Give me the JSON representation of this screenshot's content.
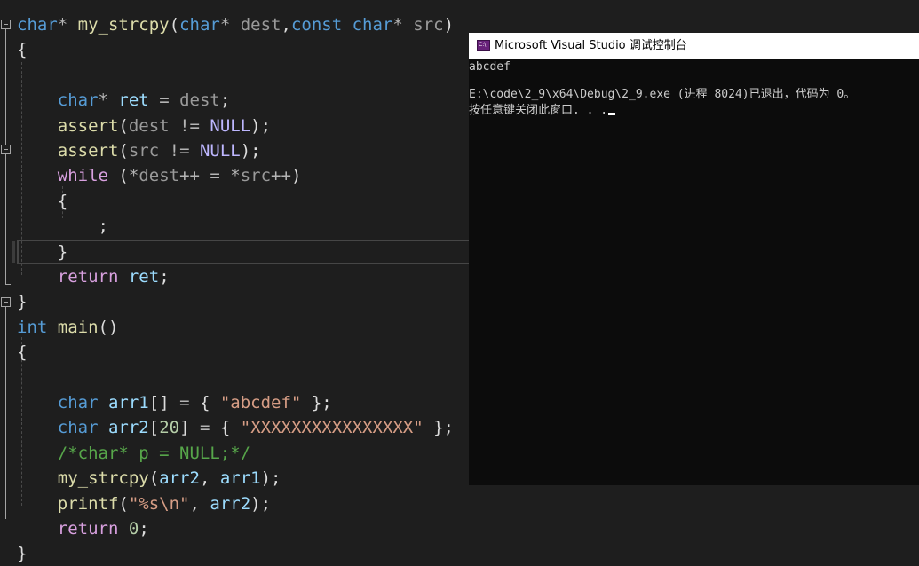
{
  "editor": {
    "lines": [
      [
        [
          "kw",
          "char"
        ],
        [
          "op",
          "* "
        ],
        [
          "fn",
          "my_strcpy"
        ],
        [
          "punct",
          "("
        ],
        [
          "kw",
          "char"
        ],
        [
          "op",
          "* "
        ],
        [
          "param",
          "dest"
        ],
        [
          "punct",
          ","
        ],
        [
          "kw",
          "const"
        ],
        [
          "punct",
          " "
        ],
        [
          "kw",
          "char"
        ],
        [
          "op",
          "* "
        ],
        [
          "param",
          "src"
        ],
        [
          "punct",
          ")"
        ]
      ],
      [
        [
          "punct",
          "{"
        ]
      ],
      [],
      [
        [
          "punct",
          "    "
        ],
        [
          "kw",
          "char"
        ],
        [
          "op",
          "* "
        ],
        [
          "var",
          "ret"
        ],
        [
          "op",
          " = "
        ],
        [
          "param",
          "dest"
        ],
        [
          "punct",
          ";"
        ]
      ],
      [
        [
          "punct",
          "    "
        ],
        [
          "fn",
          "assert"
        ],
        [
          "punct",
          "("
        ],
        [
          "param",
          "dest"
        ],
        [
          "op",
          " != "
        ],
        [
          "macro",
          "NULL"
        ],
        [
          "punct",
          ");"
        ]
      ],
      [
        [
          "punct",
          "    "
        ],
        [
          "fn",
          "assert"
        ],
        [
          "punct",
          "("
        ],
        [
          "param",
          "src"
        ],
        [
          "op",
          " != "
        ],
        [
          "macro",
          "NULL"
        ],
        [
          "punct",
          ");"
        ]
      ],
      [
        [
          "punct",
          "    "
        ],
        [
          "ctrl",
          "while"
        ],
        [
          "punct",
          " ("
        ],
        [
          "op",
          "*"
        ],
        [
          "param",
          "dest"
        ],
        [
          "op",
          "++ = *"
        ],
        [
          "param",
          "src"
        ],
        [
          "op",
          "++"
        ],
        [
          "punct",
          ")"
        ]
      ],
      [
        [
          "punct",
          "    {"
        ]
      ],
      [
        [
          "punct",
          "        ;"
        ]
      ],
      [
        [
          "punct",
          "    }"
        ]
      ],
      [
        [
          "punct",
          "    "
        ],
        [
          "ctrl",
          "return"
        ],
        [
          "punct",
          " "
        ],
        [
          "var",
          "ret"
        ],
        [
          "punct",
          ";"
        ]
      ],
      [
        [
          "punct",
          "}"
        ]
      ],
      [
        [
          "kw",
          "int"
        ],
        [
          "punct",
          " "
        ],
        [
          "fn",
          "main"
        ],
        [
          "punct",
          "()"
        ]
      ],
      [
        [
          "punct",
          "{"
        ]
      ],
      [],
      [
        [
          "punct",
          "    "
        ],
        [
          "kw",
          "char"
        ],
        [
          "punct",
          " "
        ],
        [
          "var",
          "arr1"
        ],
        [
          "punct",
          "[]"
        ],
        [
          "op",
          " = "
        ],
        [
          "punct",
          "{ "
        ],
        [
          "str",
          "\"abcdef\""
        ],
        [
          "punct",
          " };"
        ]
      ],
      [
        [
          "punct",
          "    "
        ],
        [
          "kw",
          "char"
        ],
        [
          "punct",
          " "
        ],
        [
          "var",
          "arr2"
        ],
        [
          "punct",
          "["
        ],
        [
          "num",
          "20"
        ],
        [
          "punct",
          "]"
        ],
        [
          "op",
          " = "
        ],
        [
          "punct",
          "{ "
        ],
        [
          "str",
          "\"XXXXXXXXXXXXXXXX\""
        ],
        [
          "punct",
          " };"
        ]
      ],
      [
        [
          "punct",
          "    "
        ],
        [
          "comment",
          "/*char* p = NULL;*/"
        ]
      ],
      [
        [
          "punct",
          "    "
        ],
        [
          "fn",
          "my_strcpy"
        ],
        [
          "punct",
          "("
        ],
        [
          "var",
          "arr2"
        ],
        [
          "punct",
          ", "
        ],
        [
          "var",
          "arr1"
        ],
        [
          "punct",
          ");"
        ]
      ],
      [
        [
          "punct",
          "    "
        ],
        [
          "fn",
          "printf"
        ],
        [
          "punct",
          "("
        ],
        [
          "str",
          "\"%s\\n\""
        ],
        [
          "punct",
          ", "
        ],
        [
          "var",
          "arr2"
        ],
        [
          "punct",
          ");"
        ]
      ],
      [
        [
          "punct",
          "    "
        ],
        [
          "ctrl",
          "return"
        ],
        [
          "punct",
          " "
        ],
        [
          "num",
          "0"
        ],
        [
          "punct",
          ";"
        ]
      ],
      [
        [
          "punct",
          "}"
        ]
      ]
    ]
  },
  "console": {
    "title": "Microsoft Visual Studio 调试控制台",
    "icon_name": "visual-studio-console-icon",
    "icon_text": "C:\\",
    "lines": [
      "abcdef",
      "",
      "E:\\code\\2_9\\x64\\Debug\\2_9.exe (进程 8024)已退出，代码为 0。",
      "按任意键关闭此窗口. . ."
    ]
  }
}
